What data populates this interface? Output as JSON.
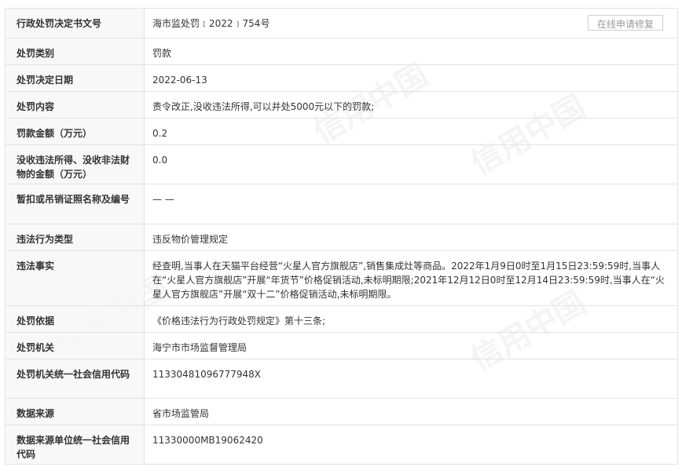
{
  "repair_button_label": "在线申请修复",
  "watermark_text": "信用中国",
  "rows": [
    {
      "label": "行政处罚决定书文号",
      "value": "海市监处罚﹝2022﹞754号"
    },
    {
      "label": "处罚类别",
      "value": "罚款"
    },
    {
      "label": "处罚决定日期",
      "value": "2022-06-13"
    },
    {
      "label": "处罚内容",
      "value": "责令改正,没收违法所得,可以并处5000元以下的罚款;"
    },
    {
      "label": "罚款金额（万元）",
      "value": "0.2"
    },
    {
      "label": "没收违法所得、没收非法财物的金额（万元）",
      "value": "0.0"
    },
    {
      "label": "暂扣或吊销证照名称及编号",
      "value": "— —"
    },
    {
      "label": "违法行为类型",
      "value": "违反物价管理规定"
    },
    {
      "label": "违法事实",
      "value": "经查明,当事人在天猫平台经营“火星人官方旗舰店”,销售集成灶等商品。2022年1月9日0时至1月15日23:59:59时,当事人在“火星人官方旗舰店”开展“年货节”价格促销活动,未标明期限;2021年12月12日0时至12月14日23:59:59时,当事人在“火星人官方旗舰店”开展“双十二”价格促销活动,未标明期限。"
    },
    {
      "label": "处罚依据",
      "value": "《价格违法行为行政处罚规定》第十三条;"
    },
    {
      "label": "处罚机关",
      "value": "海宁市市场监督管理局"
    },
    {
      "label": "处罚机关统一社会信用代码",
      "value": "11330481096777948X"
    },
    {
      "label": "数据来源",
      "value": "省市场监管局"
    },
    {
      "label": "数据来源单位统一社会信用代码",
      "value": "11330000MB19062420"
    }
  ]
}
